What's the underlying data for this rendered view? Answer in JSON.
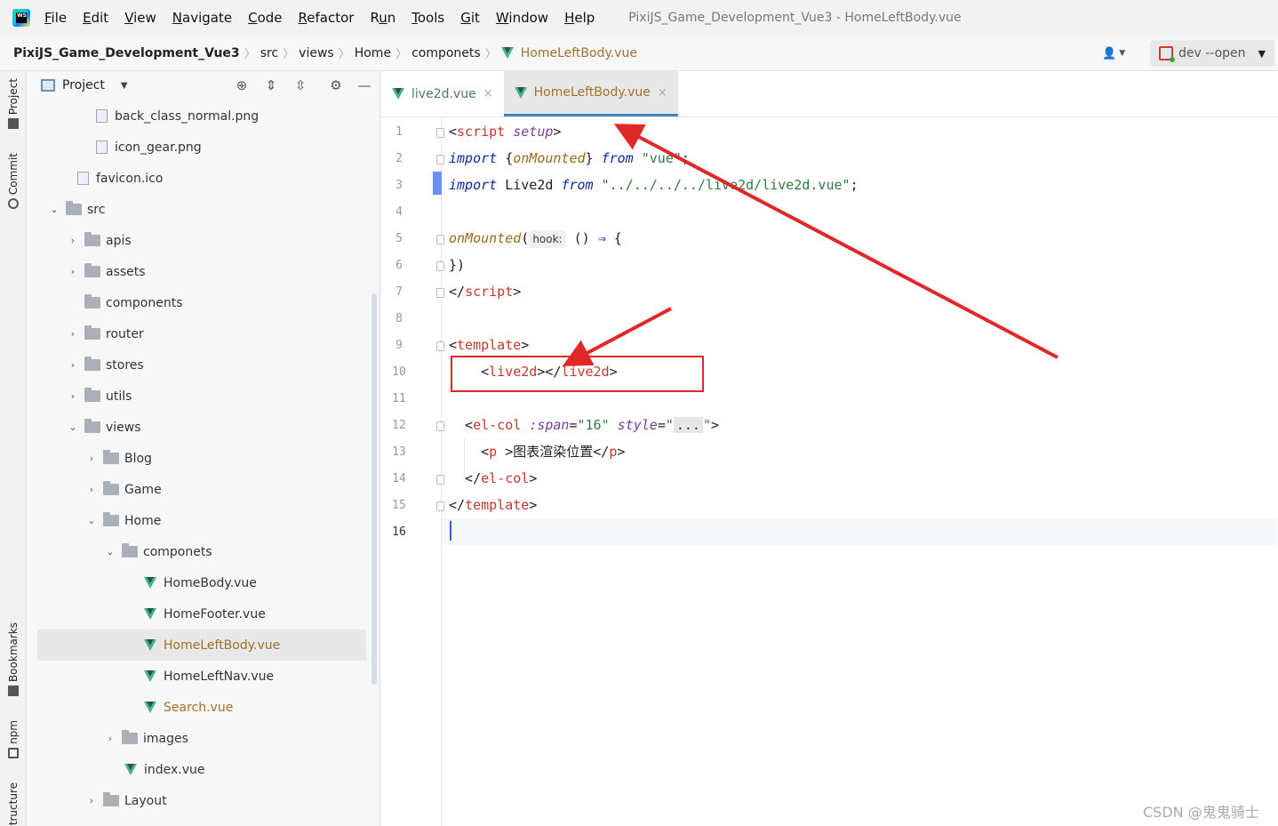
{
  "app": {
    "logo_text": "WS"
  },
  "menu": [
    {
      "mn": "F",
      "rest": "ile"
    },
    {
      "mn": "E",
      "rest": "dit"
    },
    {
      "mn": "V",
      "rest": "iew"
    },
    {
      "mn": "N",
      "rest": "avigate"
    },
    {
      "mn": "C",
      "rest": "ode"
    },
    {
      "mn": "R",
      "rest": "efactor"
    },
    {
      "mn": "R",
      "rest": "un",
      "pre": "R",
      "mn2": "u"
    },
    {
      "mn": "T",
      "rest": "ools"
    },
    {
      "mn": "G",
      "rest": "it"
    },
    {
      "mn": "W",
      "rest": "indow"
    },
    {
      "mn": "H",
      "rest": "elp"
    }
  ],
  "window_title": "PixiJS_Game_Development_Vue3 - HomeLeftBody.vue",
  "breadcrumb": [
    "PixiJS_Game_Development_Vue3",
    "src",
    "views",
    "Home",
    "componets",
    "HomeLeftBody.vue"
  ],
  "run_config": {
    "label": "dev --open"
  },
  "toolstrip": {
    "project": "Project",
    "commit": "Commit",
    "bookmarks": "Bookmarks",
    "npm": "npm",
    "structure": "Structure"
  },
  "panel": {
    "title": "Project"
  },
  "tree": [
    {
      "label": "back_class_normal.png"
    },
    {
      "label": "icon_gear.png"
    },
    {
      "label": "favicon.ico"
    },
    {
      "label": "src"
    },
    {
      "label": "apis"
    },
    {
      "label": "assets"
    },
    {
      "label": "components"
    },
    {
      "label": "router"
    },
    {
      "label": "stores"
    },
    {
      "label": "utils"
    },
    {
      "label": "views"
    },
    {
      "label": "Blog"
    },
    {
      "label": "Game"
    },
    {
      "label": "Home"
    },
    {
      "label": "componets"
    },
    {
      "label": "HomeBody.vue"
    },
    {
      "label": "HomeFooter.vue"
    },
    {
      "label": "HomeLeftBody.vue"
    },
    {
      "label": "HomeLeftNav.vue"
    },
    {
      "label": "Search.vue"
    },
    {
      "label": "images"
    },
    {
      "label": "index.vue"
    },
    {
      "label": "Layout"
    }
  ],
  "tabs": [
    {
      "label": "live2d.vue",
      "close": "×"
    },
    {
      "label": "HomeLeftBody.vue",
      "close": "×"
    }
  ],
  "line_numbers": [
    "1",
    "2",
    "3",
    "4",
    "5",
    "6",
    "7",
    "8",
    "9",
    "10",
    "11",
    "12",
    "13",
    "14",
    "15",
    "16"
  ],
  "code": {
    "l1": [
      "<",
      "script",
      " ",
      "setup",
      ">"
    ],
    "l2": [
      "import",
      " {",
      "onMounted",
      "} ",
      "from",
      " ",
      "\"vue\"",
      ";"
    ],
    "l3": [
      "import",
      " Live2d ",
      "from",
      " ",
      "\"../../../../live2d/live2d.vue\"",
      ";"
    ],
    "l5": [
      "onMounted",
      "(",
      "hook:",
      " () ",
      "⇒",
      " {"
    ],
    "l6": [
      "})"
    ],
    "l7": [
      "</",
      "script",
      ">"
    ],
    "l9": [
      "<",
      "template",
      ">"
    ],
    "l10": [
      "    <",
      "live2d",
      "></",
      "live2d",
      ">"
    ],
    "l12": [
      "  <",
      "el-col",
      " ",
      ":span",
      "=",
      "\"16\"",
      " ",
      "style",
      "=",
      "\"",
      "...",
      "\"",
      ">"
    ],
    "l13": [
      "    <",
      "p",
      " >",
      "图表渲染位置",
      "</",
      "p",
      ">"
    ],
    "l14": [
      "  </",
      "el-col",
      ">"
    ],
    "l15": [
      "</",
      "template",
      ">"
    ]
  },
  "watermark": "CSDN @鬼鬼骑士",
  "colors": {
    "annotation": "#e02828",
    "vue_green": "#41b883",
    "modified": "#a0702c"
  }
}
